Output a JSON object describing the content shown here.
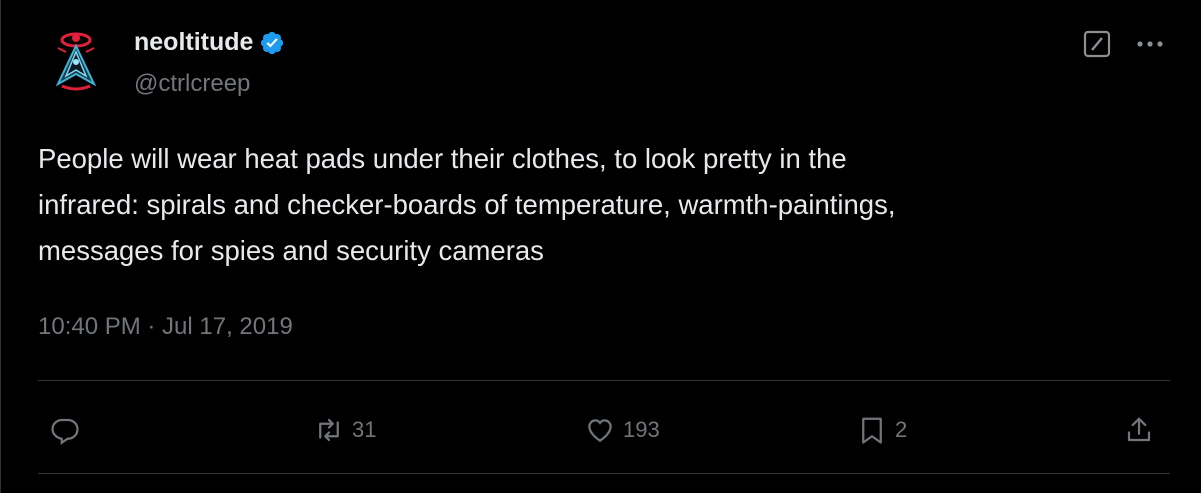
{
  "author": {
    "display_name": "neoltitude",
    "handle": "@ctrlcreep",
    "verified": true
  },
  "tweet": {
    "text": "People will wear heat pads under their clothes, to look pretty in the\ninfrared: spirals and checker-boards of temperature, warmth-paintings,\nmessages for spies and security cameras",
    "timestamp": "10:40 PM · Jul 17, 2019"
  },
  "actions": {
    "reply_icon": "reply-icon",
    "retweet_count": "31",
    "like_count": "193",
    "bookmark_count": "2",
    "share_icon": "share-icon"
  },
  "colors": {
    "background": "#000000",
    "text": "#e7e9ea",
    "muted": "#71767b",
    "divider": "#2f3336",
    "verified": "#1d9bf0"
  }
}
